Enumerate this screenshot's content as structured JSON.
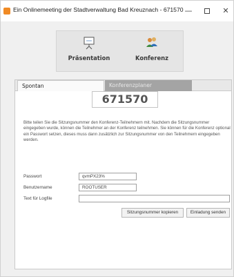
{
  "window": {
    "title": "Ein Onlinemeeting der Stadtverwaltung Bad Kreuznach - 671570",
    "minimize_glyph": "—",
    "close_glyph": "✕"
  },
  "modes": {
    "presentation_label": "Präsentation",
    "conference_label": "Konferenz",
    "presentation_icon": "presentation-board-icon",
    "conference_icon": "users-group-icon"
  },
  "tabs": [
    {
      "label": "Spontan",
      "active": true
    },
    {
      "label": "Konferenzplaner",
      "active": false
    }
  ],
  "session": {
    "number": "671570",
    "info": "Bitte teilen Sie die Sitzungsnummer den Konferenz-Teilnehmern mit. Nachdem die Sitzungsnummer eingegeben wurde, können die Teilnehmer an der Konferenz teilnehmen. Sie können für die Konferenz optional ein Passwort setzen, dieses muss dann zusätzlich zur Sitzungsnummer von den Teilnehmern eingegeben werden."
  },
  "form": {
    "password_label": "Passwort",
    "password_value": "qvmPX23%",
    "username_label": "Benutzername",
    "username_value": "ROOTUSER",
    "logfile_label": "Text für Logfile",
    "logfile_value": ""
  },
  "actions": {
    "copy_label": "Sitzungsnummer kopieren",
    "invite_label": "Einladung senden"
  },
  "colors": {
    "accent_icon": "#f08a24",
    "inactive_tab": "#a4a4a4"
  }
}
